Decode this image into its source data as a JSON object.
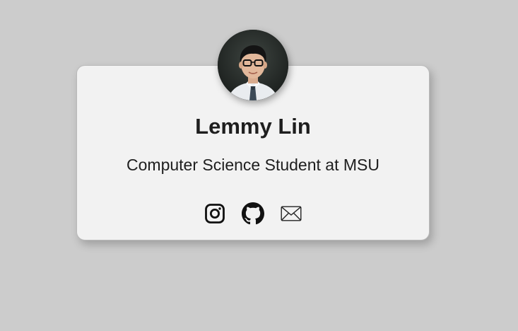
{
  "profile": {
    "name": "Lemmy Lin",
    "title": "Computer Science Student at MSU"
  },
  "socials": [
    {
      "icon": "instagram-icon"
    },
    {
      "icon": "github-icon"
    },
    {
      "icon": "email-icon"
    }
  ],
  "colors": {
    "background": "#cccccc",
    "card": "#f2f2f2",
    "text": "#1e1e1e"
  }
}
